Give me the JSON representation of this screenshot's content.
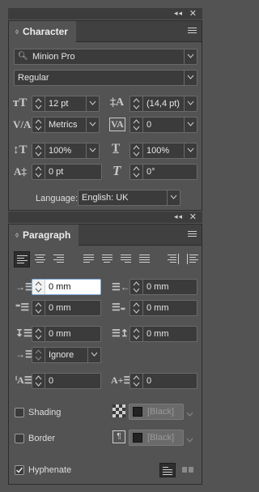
{
  "character": {
    "title": "Character",
    "font_family": "Minion Pro",
    "font_style": "Regular",
    "font_size": "12 pt",
    "leading": "(14,4 pt)",
    "kerning": "Metrics",
    "tracking": "0",
    "vertical_scale": "100%",
    "horizontal_scale": "100%",
    "baseline_shift": "0 pt",
    "skew": "0°",
    "language_label": "Language:",
    "language": "English: UK"
  },
  "paragraph": {
    "title": "Paragraph",
    "left_indent": "0 mm",
    "right_indent": "0 mm",
    "first_line_indent": "0 mm",
    "last_line_indent": "0 mm",
    "space_before": "0 mm",
    "space_after": "0 mm",
    "align_to_grid": "Ignore",
    "drop_cap_lines": "0",
    "drop_cap_chars": "0",
    "shading_label": "Shading",
    "shading_swatch": "[Black]",
    "border_label": "Border",
    "border_swatch": "[Black]",
    "hyphenate_label": "Hyphenate",
    "hyphenate_checked": true
  },
  "colors": {
    "panel_bg": "#535353",
    "field_bg": "#3b3b3b",
    "active_field": "#ffffff"
  }
}
